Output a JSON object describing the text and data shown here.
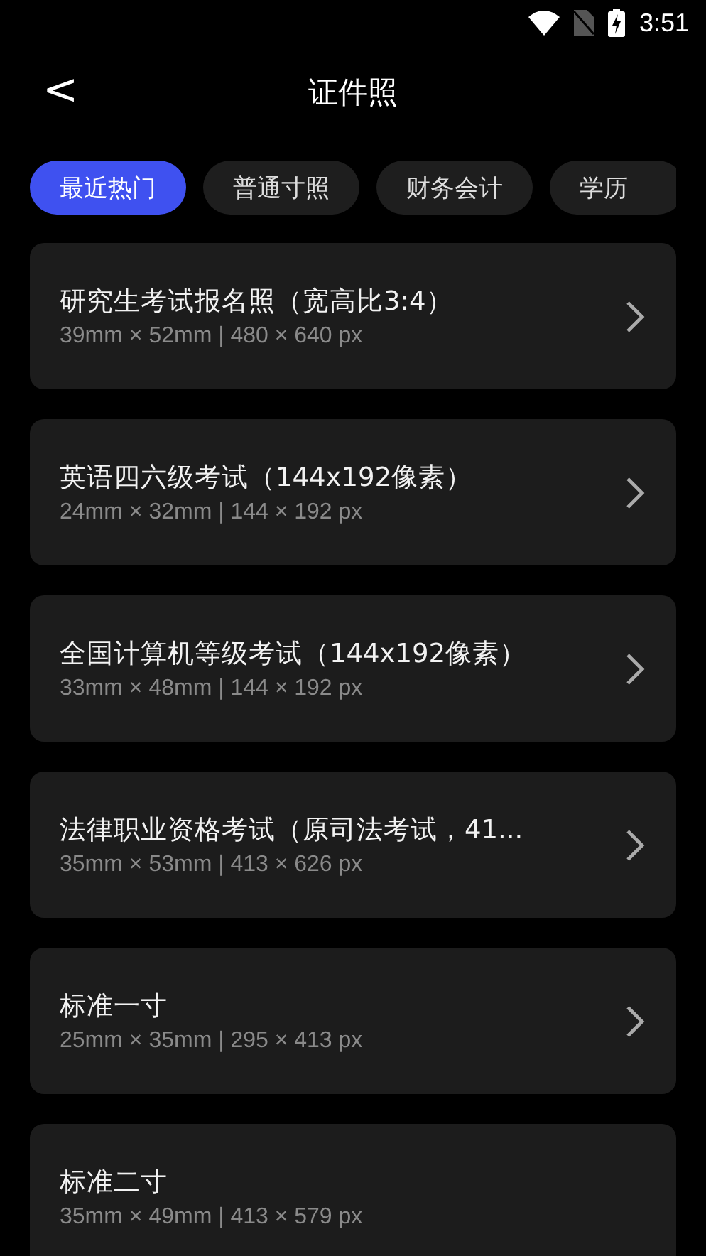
{
  "status_bar": {
    "time": "3:51"
  },
  "header": {
    "back": "<",
    "title": "证件照"
  },
  "tabs": [
    {
      "label": "最近热门",
      "selected": true
    },
    {
      "label": "普通寸照",
      "selected": false
    },
    {
      "label": "财务会计",
      "selected": false
    },
    {
      "label": "学历",
      "selected": false
    }
  ],
  "items": [
    {
      "title": "研究生考试报名照（宽高比3:4）",
      "size": "39mm × 52mm | 480 × 640 px",
      "arrow": true
    },
    {
      "title": "英语四六级考试（144x192像素）",
      "size": "24mm × 32mm | 144 × 192 px",
      "arrow": true
    },
    {
      "title": "全国计算机等级考试（144x192像素）",
      "size": "33mm × 48mm | 144 × 192 px",
      "arrow": true
    },
    {
      "title": "法律职业资格考试（原司法考试，41...",
      "size": "35mm × 53mm | 413 × 626 px",
      "arrow": true
    },
    {
      "title": "标准一寸",
      "size": "25mm × 35mm | 295 × 413 px",
      "arrow": true
    },
    {
      "title": "标准二寸",
      "size": "35mm × 49mm | 413 × 579 px",
      "arrow": false
    }
  ]
}
